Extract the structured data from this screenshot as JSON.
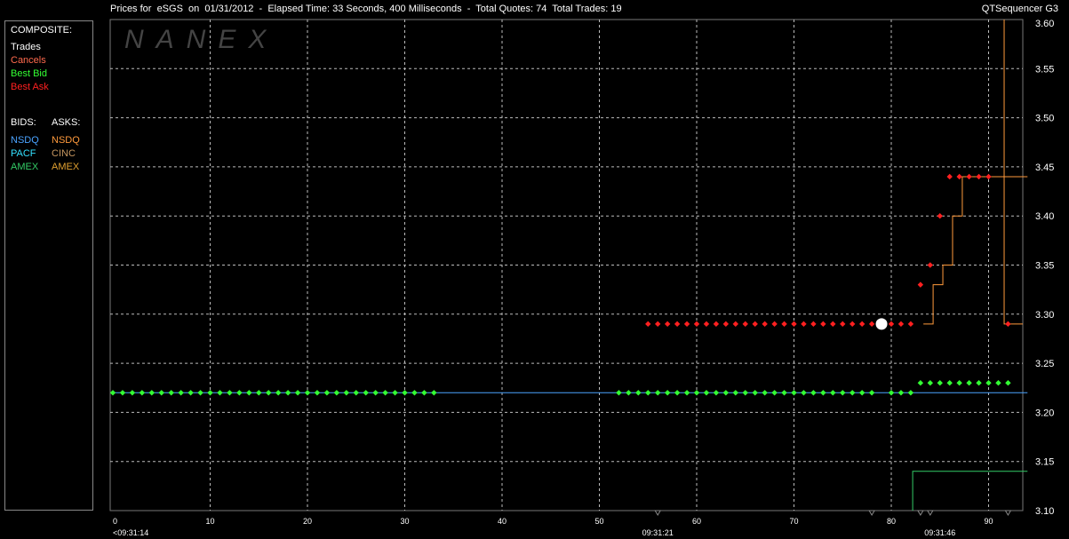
{
  "header": {
    "title": "Prices for  eSGS  on  01/31/2012  -  Elapsed Time: 33 Seconds, 400 Milliseconds  -  Total Quotes: 74  Total Trades: 19",
    "app": "QTSequencer G3"
  },
  "legend": {
    "composite_label": "COMPOSITE:",
    "composite": [
      {
        "label": "Trades",
        "color": "#ffffff"
      },
      {
        "label": "Cancels",
        "color": "#ff6a4d"
      },
      {
        "label": "Best Bid",
        "color": "#33ff33"
      },
      {
        "label": "Best Ask",
        "color": "#ff2020"
      }
    ],
    "bids_label": "BIDS:",
    "asks_label": "ASKS:",
    "bids": [
      {
        "label": "NSDQ",
        "color": "#4aa3ff"
      },
      {
        "label": "PACF",
        "color": "#33e0ff"
      },
      {
        "label": "AMEX",
        "color": "#33cc66"
      }
    ],
    "asks": [
      {
        "label": "NSDQ",
        "color": "#ff9a3c"
      },
      {
        "label": "CINC",
        "color": "#c89860"
      },
      {
        "label": "AMEX",
        "color": "#e0a030"
      }
    ]
  },
  "watermark": "NANEX",
  "chart_data": {
    "type": "line",
    "xlim": [
      0,
      94
    ],
    "ylim": [
      3.1,
      3.6
    ],
    "x_ticks": [
      0,
      10,
      20,
      30,
      40,
      50,
      60,
      70,
      80,
      90
    ],
    "y_ticks": [
      "3.10",
      "3.15",
      "3.20",
      "3.25",
      "3.30",
      "3.35",
      "3.40",
      "3.45",
      "3.50",
      "3.55",
      "3.60"
    ],
    "time_labels": [
      {
        "x": 0,
        "label": "<09:31:14"
      },
      {
        "x": 56,
        "label": "09:31:21"
      },
      {
        "x": 85,
        "label": "09:31:46"
      }
    ],
    "grid": true,
    "series": [
      {
        "name": "Best Bid",
        "color": "#33ff33",
        "points": [
          [
            0,
            3.22
          ],
          [
            1,
            3.22
          ],
          [
            2,
            3.22
          ],
          [
            3,
            3.22
          ],
          [
            4,
            3.22
          ],
          [
            5,
            3.22
          ],
          [
            6,
            3.22
          ],
          [
            7,
            3.22
          ],
          [
            8,
            3.22
          ],
          [
            9,
            3.22
          ],
          [
            10,
            3.22
          ],
          [
            11,
            3.22
          ],
          [
            12,
            3.22
          ],
          [
            13,
            3.22
          ],
          [
            14,
            3.22
          ],
          [
            15,
            3.22
          ],
          [
            16,
            3.22
          ],
          [
            17,
            3.22
          ],
          [
            18,
            3.22
          ],
          [
            19,
            3.22
          ],
          [
            20,
            3.22
          ],
          [
            21,
            3.22
          ],
          [
            22,
            3.22
          ],
          [
            23,
            3.22
          ],
          [
            24,
            3.22
          ],
          [
            25,
            3.22
          ],
          [
            26,
            3.22
          ],
          [
            27,
            3.22
          ],
          [
            28,
            3.22
          ],
          [
            29,
            3.22
          ],
          [
            30,
            3.22
          ],
          [
            31,
            3.22
          ],
          [
            32,
            3.22
          ],
          [
            33,
            3.22
          ],
          [
            52,
            3.22
          ],
          [
            53,
            3.22
          ],
          [
            54,
            3.22
          ],
          [
            55,
            3.22
          ],
          [
            56,
            3.22
          ],
          [
            57,
            3.22
          ],
          [
            58,
            3.22
          ],
          [
            59,
            3.22
          ],
          [
            60,
            3.22
          ],
          [
            61,
            3.22
          ],
          [
            62,
            3.22
          ],
          [
            63,
            3.22
          ],
          [
            64,
            3.22
          ],
          [
            65,
            3.22
          ],
          [
            66,
            3.22
          ],
          [
            67,
            3.22
          ],
          [
            68,
            3.22
          ],
          [
            69,
            3.22
          ],
          [
            70,
            3.22
          ],
          [
            71,
            3.22
          ],
          [
            72,
            3.22
          ],
          [
            73,
            3.22
          ],
          [
            74,
            3.22
          ],
          [
            75,
            3.22
          ],
          [
            76,
            3.22
          ],
          [
            77,
            3.22
          ],
          [
            78,
            3.22
          ],
          [
            80,
            3.22
          ],
          [
            81,
            3.22
          ],
          [
            82,
            3.22
          ],
          [
            83,
            3.23
          ],
          [
            84,
            3.23
          ],
          [
            85,
            3.23
          ],
          [
            86,
            3.23
          ],
          [
            87,
            3.23
          ],
          [
            88,
            3.23
          ],
          [
            89,
            3.23
          ],
          [
            90,
            3.23
          ],
          [
            91,
            3.23
          ],
          [
            92,
            3.23
          ]
        ]
      },
      {
        "name": "Best Ask",
        "color": "#ff2020",
        "points": [
          [
            55,
            3.29
          ],
          [
            56,
            3.29
          ],
          [
            57,
            3.29
          ],
          [
            58,
            3.29
          ],
          [
            59,
            3.29
          ],
          [
            60,
            3.29
          ],
          [
            61,
            3.29
          ],
          [
            62,
            3.29
          ],
          [
            63,
            3.29
          ],
          [
            64,
            3.29
          ],
          [
            65,
            3.29
          ],
          [
            66,
            3.29
          ],
          [
            67,
            3.29
          ],
          [
            68,
            3.29
          ],
          [
            69,
            3.29
          ],
          [
            70,
            3.29
          ],
          [
            71,
            3.29
          ],
          [
            72,
            3.29
          ],
          [
            73,
            3.29
          ],
          [
            74,
            3.29
          ],
          [
            75,
            3.29
          ],
          [
            76,
            3.29
          ],
          [
            77,
            3.29
          ],
          [
            78,
            3.29
          ],
          [
            79,
            3.29
          ],
          [
            80,
            3.29
          ],
          [
            81,
            3.29
          ],
          [
            82,
            3.29
          ],
          [
            83,
            3.33
          ],
          [
            84,
            3.35
          ],
          [
            85,
            3.4
          ],
          [
            86,
            3.44
          ],
          [
            87,
            3.44
          ],
          [
            88,
            3.44
          ],
          [
            89,
            3.44
          ],
          [
            90,
            3.44
          ],
          [
            92,
            3.29
          ]
        ]
      },
      {
        "name": "Trades",
        "color": "#ffffff",
        "points": [
          [
            79,
            3.29
          ]
        ]
      },
      {
        "name": "NSDQ bid",
        "color": "#4aa3ff",
        "step": [
          [
            0,
            3.22
          ],
          [
            94,
            3.22
          ]
        ]
      },
      {
        "name": "NSDQ ask",
        "color": "#ff9a3c",
        "step": [
          [
            83.3,
            3.29
          ],
          [
            84.3,
            3.33
          ],
          [
            85.3,
            3.35
          ],
          [
            86.3,
            3.4
          ],
          [
            87.3,
            3.44
          ],
          [
            94,
            3.44
          ]
        ]
      },
      {
        "name": "AMEX bid",
        "color": "#33cc66",
        "step": [
          [
            82.2,
            3.1
          ],
          [
            82.2,
            3.14
          ],
          [
            94,
            3.14
          ]
        ]
      }
    ]
  }
}
